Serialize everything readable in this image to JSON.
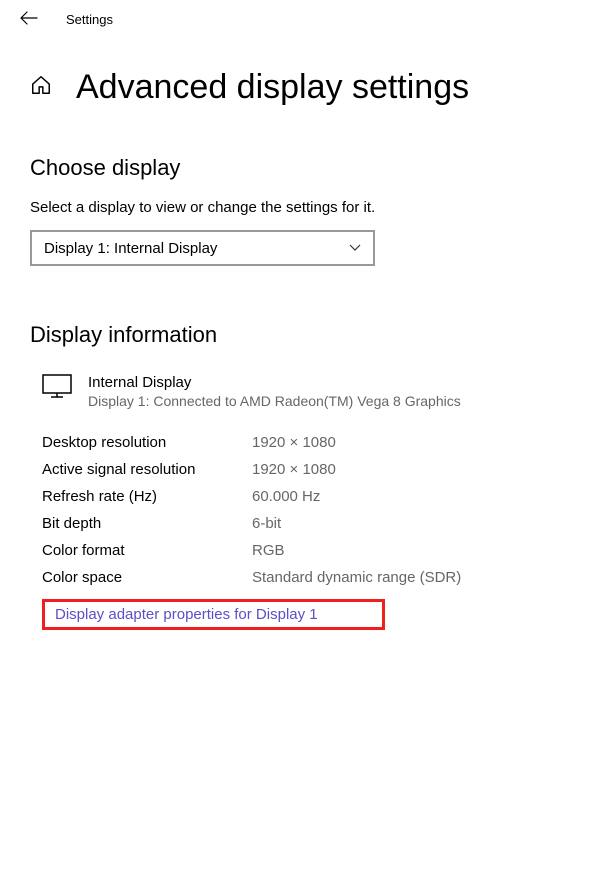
{
  "topbar": {
    "title": "Settings"
  },
  "page": {
    "title": "Advanced display settings"
  },
  "choose": {
    "heading": "Choose display",
    "subtext": "Select a display to view or change the settings for it.",
    "dropdown_value": "Display 1: Internal Display"
  },
  "info": {
    "heading": "Display information",
    "display_name": "Internal Display",
    "connected_text": "Display 1: Connected to AMD Radeon(TM) Vega 8 Graphics",
    "rows": [
      {
        "label": "Desktop resolution",
        "value": "1920 × 1080"
      },
      {
        "label": "Active signal resolution",
        "value": "1920 × 1080"
      },
      {
        "label": "Refresh rate (Hz)",
        "value": "60.000 Hz"
      },
      {
        "label": "Bit depth",
        "value": "6-bit"
      },
      {
        "label": "Color format",
        "value": "RGB"
      },
      {
        "label": "Color space",
        "value": "Standard dynamic range (SDR)"
      }
    ],
    "adapter_link": "Display adapter properties for Display 1"
  }
}
